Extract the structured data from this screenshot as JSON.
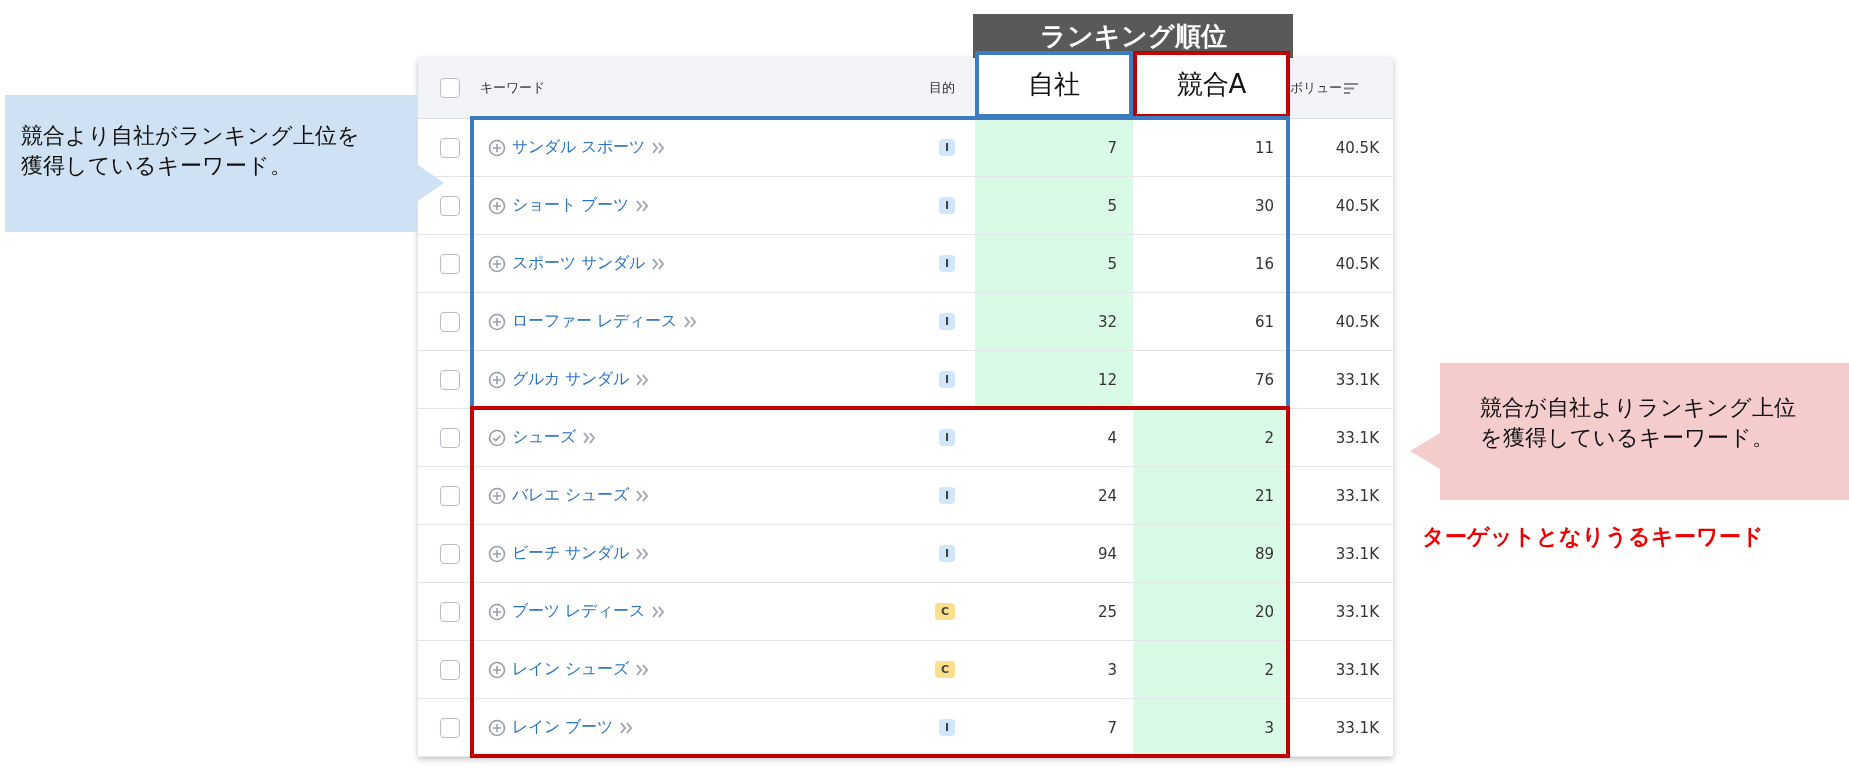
{
  "ranking_title": "ランキング順位",
  "table": {
    "all_checked": false,
    "columns": [
      {
        "label": "キーワード"
      },
      {
        "label": "目的"
      },
      {
        "label": "自社",
        "color": "#3d7cc0"
      },
      {
        "label": "競合A",
        "color": "#c00000"
      },
      {
        "label": "ボリュー"
      }
    ],
    "groups": [
      {
        "color": "#3d7cc0",
        "rows": [
          {
            "checked": false,
            "keyword": "サンダル スポーツ",
            "added": false,
            "intent": {
              "label": "I",
              "color": "#cfe6fb"
            },
            "own": "7",
            "competitor": "11",
            "own_highlighted": true,
            "competitor_highlighted": false,
            "volume": "40.5K"
          },
          {
            "checked": false,
            "keyword": "ショート ブーツ",
            "added": false,
            "intent": {
              "label": "I",
              "color": "#cfe6fb"
            },
            "own": "5",
            "competitor": "30",
            "own_highlighted": true,
            "competitor_highlighted": false,
            "volume": "40.5K"
          },
          {
            "checked": false,
            "keyword": "スポーツ サンダル",
            "added": false,
            "intent": {
              "label": "I",
              "color": "#cfe6fb"
            },
            "own": "5",
            "competitor": "16",
            "own_highlighted": true,
            "competitor_highlighted": false,
            "volume": "40.5K"
          },
          {
            "checked": false,
            "keyword": "ローファー レディース",
            "added": false,
            "intent": {
              "label": "I",
              "color": "#cfe6fb"
            },
            "own": "32",
            "competitor": "61",
            "own_highlighted": true,
            "competitor_highlighted": false,
            "volume": "40.5K"
          },
          {
            "checked": false,
            "keyword": "グルカ サンダル",
            "added": false,
            "intent": {
              "label": "I",
              "color": "#cfe6fb"
            },
            "own": "12",
            "competitor": "76",
            "own_highlighted": true,
            "competitor_highlighted": false,
            "volume": "33.1K"
          }
        ]
      },
      {
        "color": "#c00000",
        "rows": [
          {
            "checked": false,
            "keyword": "シューズ",
            "added": true,
            "intent": {
              "label": "I",
              "color": "#cfe6fb"
            },
            "own": "4",
            "competitor": "2",
            "own_highlighted": false,
            "competitor_highlighted": true,
            "volume": "33.1K"
          },
          {
            "checked": false,
            "keyword": "バレエ シューズ",
            "added": false,
            "intent": {
              "label": "I",
              "color": "#cfe6fb"
            },
            "own": "24",
            "competitor": "21",
            "own_highlighted": false,
            "competitor_highlighted": true,
            "volume": "33.1K"
          },
          {
            "checked": false,
            "keyword": "ビーチ サンダル",
            "added": false,
            "intent": {
              "label": "I",
              "color": "#cfe6fb"
            },
            "own": "94",
            "competitor": "89",
            "own_highlighted": false,
            "competitor_highlighted": true,
            "volume": "33.1K"
          },
          {
            "checked": false,
            "keyword": "ブーツ レディース",
            "added": false,
            "intent": {
              "label": "C",
              "color": "#fbe08c"
            },
            "own": "25",
            "competitor": "20",
            "own_highlighted": false,
            "competitor_highlighted": true,
            "volume": "33.1K"
          },
          {
            "checked": false,
            "keyword": "レイン シューズ",
            "added": false,
            "intent": {
              "label": "C",
              "color": "#fbe08c"
            },
            "own": "3",
            "competitor": "2",
            "own_highlighted": false,
            "competitor_highlighted": true,
            "volume": "33.1K"
          },
          {
            "checked": false,
            "keyword": "レイン ブーツ",
            "added": false,
            "intent": {
              "label": "I",
              "color": "#cfe6fb"
            },
            "own": "7",
            "competitor": "3",
            "own_highlighted": false,
            "competitor_highlighted": true,
            "volume": "33.1K"
          }
        ]
      }
    ]
  },
  "callouts": [
    {
      "text": "競合より自社がランキング上位を獲得しているキーワード。",
      "color": "#cfe2f3"
    },
    {
      "text": "競合が自社よりランキング上位を獲得しているキーワード。",
      "color": "#f4cccc"
    }
  ],
  "target_note": "ターゲットとなりうるキーワード"
}
